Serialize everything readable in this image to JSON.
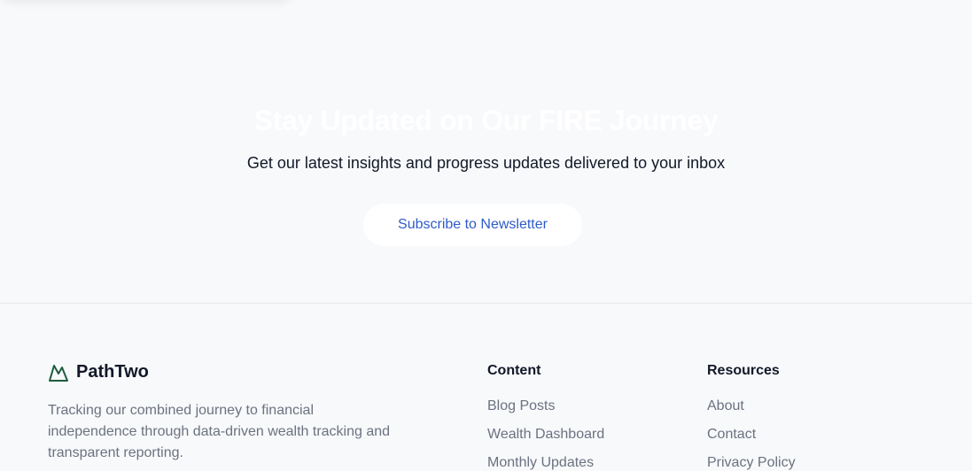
{
  "newsletter": {
    "title": "Stay Updated on Our FIRE Journey",
    "subtitle": "Get our latest insights and progress updates delivered to your inbox",
    "button_label": "Subscribe to Newsletter"
  },
  "footer": {
    "brand": {
      "name": "PathTwo",
      "icon": "mountain-icon",
      "description": "Tracking our combined journey to financial independence through data-driven wealth tracking and transparent reporting."
    },
    "columns": [
      {
        "heading": "Content",
        "links": [
          "Blog Posts",
          "Wealth Dashboard",
          "Monthly Updates"
        ]
      },
      {
        "heading": "Resources",
        "links": [
          "About",
          "Contact",
          "Privacy Policy"
        ]
      }
    ]
  },
  "colors": {
    "background": "#f8f9fb",
    "accent": "#2f5bc8",
    "brand_icon": "#1f5c3f",
    "muted_text": "#6b7280"
  }
}
